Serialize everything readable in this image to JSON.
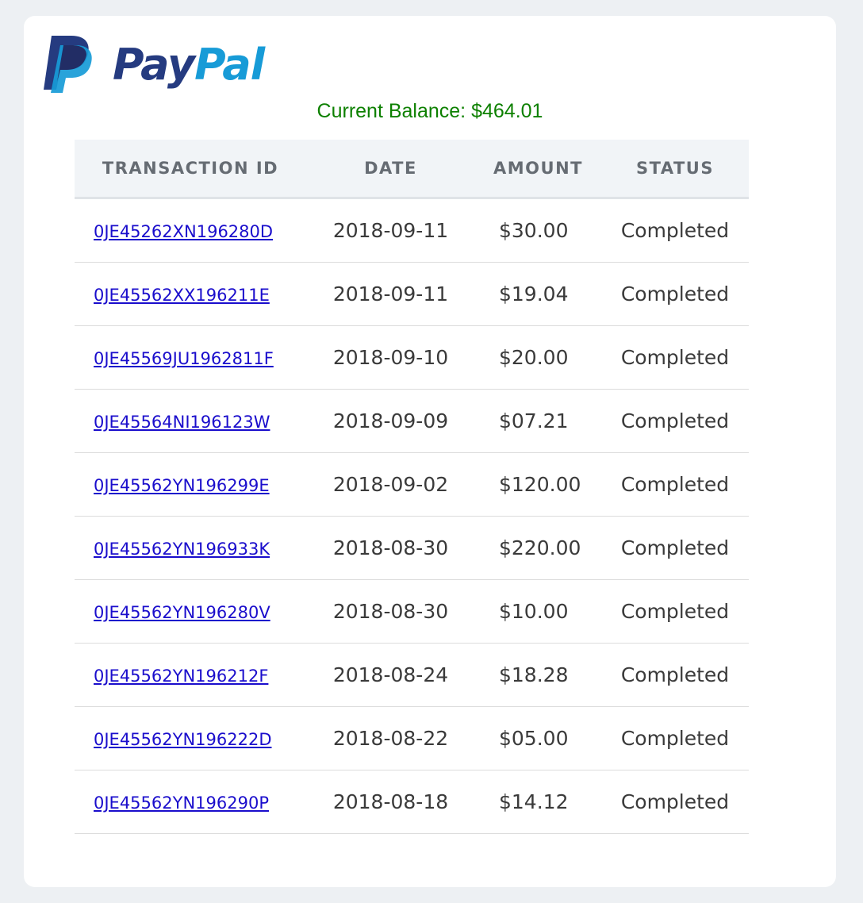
{
  "brand": {
    "logo_icon": "paypal-logo-icon",
    "name_part1": "Pay",
    "name_part2": "Pal",
    "colors": {
      "dark_blue": "#253b80",
      "light_blue": "#179bd7"
    }
  },
  "balance": {
    "text": "Current Balance: $464.01",
    "color": "#0d8000"
  },
  "table": {
    "headers": [
      "TRANSACTION ID",
      "DATE",
      "AMOUNT",
      "STATUS"
    ],
    "rows": [
      {
        "id": "0JE45262XN196280D",
        "date": "2018-09-11",
        "amount": "$30.00",
        "status": "Completed"
      },
      {
        "id": "0JE45562XX196211E",
        "date": "2018-09-11",
        "amount": "$19.04",
        "status": "Completed"
      },
      {
        "id": "0JE45569JU1962811F",
        "date": "2018-09-10",
        "amount": "$20.00",
        "status": "Completed"
      },
      {
        "id": "0JE45564NI196123W",
        "date": "2018-09-09",
        "amount": "$07.21",
        "status": "Completed"
      },
      {
        "id": "0JE45562YN196299E",
        "date": "2018-09-02",
        "amount": "$120.00",
        "status": "Completed"
      },
      {
        "id": "0JE45562YN196933K",
        "date": "2018-08-30",
        "amount": "$220.00",
        "status": "Completed"
      },
      {
        "id": "0JE45562YN196280V",
        "date": "2018-08-30",
        "amount": "$10.00",
        "status": "Completed"
      },
      {
        "id": "0JE45562YN196212F",
        "date": "2018-08-24",
        "amount": "$18.28",
        "status": "Completed"
      },
      {
        "id": "0JE45562YN196222D",
        "date": "2018-08-22",
        "amount": "$05.00",
        "status": "Completed"
      },
      {
        "id": "0JE45562YN196290P",
        "date": "2018-08-18",
        "amount": "$14.12",
        "status": "Completed"
      }
    ]
  }
}
